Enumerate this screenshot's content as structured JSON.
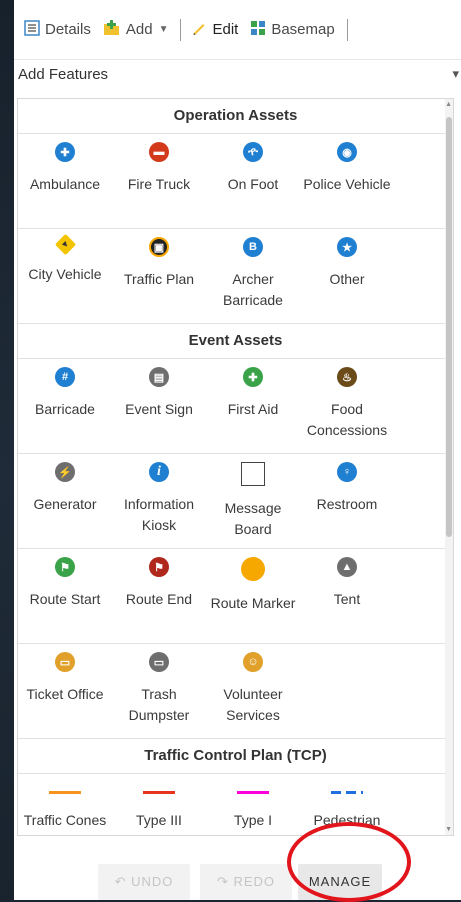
{
  "toolbar": {
    "details": "Details",
    "add": "Add",
    "edit": "Edit",
    "basemap": "Basemap"
  },
  "panel": {
    "title": "Add Features"
  },
  "groups": [
    {
      "header": "Operation Assets",
      "items": [
        {
          "label": "Ambulance",
          "icon": "ambulance-icon",
          "color": "#1f7fd1",
          "glyph": "✚"
        },
        {
          "label": "Fire Truck",
          "icon": "fire-truck-icon",
          "color": "#d33a1b",
          "glyph": "▬"
        },
        {
          "label": "On Foot",
          "icon": "walking-person-icon",
          "color": "#1f7fd1",
          "glyph": "ዯ"
        },
        {
          "label": "Police Vehicle",
          "icon": "police-car-icon",
          "color": "#1f7fd1",
          "glyph": "◉"
        },
        {
          "label": "City Vehicle",
          "icon": "city-vehicle-icon",
          "color": "#f5c400",
          "glyph": "▸"
        },
        {
          "label": "Traffic Plan",
          "icon": "traffic-plan-icon",
          "color": "#222222",
          "glyph": "▣"
        },
        {
          "label": "Archer Barricade",
          "icon": "archer-barricade-icon",
          "color": "#1f7fd1",
          "glyph": "B"
        },
        {
          "label": "Other",
          "icon": "star-badge-icon",
          "color": "#1f7fd1",
          "glyph": "★"
        }
      ]
    },
    {
      "header": "Event Assets",
      "items": [
        {
          "label": "Barricade",
          "icon": "barricade-icon",
          "color": "#1f7fd1",
          "glyph": "#"
        },
        {
          "label": "Event Sign",
          "icon": "event-sign-icon",
          "color": "#6e6e6e",
          "glyph": "▤"
        },
        {
          "label": "First Aid",
          "icon": "first-aid-icon",
          "color": "#3aa34a",
          "glyph": "✚"
        },
        {
          "label": "Food Concessions",
          "icon": "food-icon",
          "color": "#6b4b18",
          "glyph": "♨"
        },
        {
          "label": "Generator",
          "icon": "generator-icon",
          "color": "#6e6e6e",
          "glyph": "⚡"
        },
        {
          "label": "Information Kiosk",
          "icon": "information-icon",
          "color": "#1f7fd1",
          "glyph": "i"
        },
        {
          "label": "Message Board",
          "icon": "message-board-icon",
          "color": "#ffffff",
          "glyph": ""
        },
        {
          "label": "Restroom",
          "icon": "restroom-icon",
          "color": "#1f7fd1",
          "glyph": "♀"
        },
        {
          "label": "Route Start",
          "icon": "route-start-flag-icon",
          "color": "#3aa34a",
          "glyph": "⚑"
        },
        {
          "label": "Route End",
          "icon": "route-end-flag-icon",
          "color": "#b0281c",
          "glyph": "⚑"
        },
        {
          "label": "Route Marker",
          "icon": "route-marker-icon",
          "color": "#f7a800",
          "glyph": ""
        },
        {
          "label": "Tent",
          "icon": "tent-icon",
          "color": "#6e6e6e",
          "glyph": "▲"
        },
        {
          "label": "Ticket Office",
          "icon": "ticket-icon",
          "color": "#e0a02a",
          "glyph": "▭"
        },
        {
          "label": "Trash Dumpster",
          "icon": "trash-dumpster-icon",
          "color": "#6e6e6e",
          "glyph": "▭"
        },
        {
          "label": "Volunteer Services",
          "icon": "volunteer-icon",
          "color": "#e0a02a",
          "glyph": "☺"
        }
      ]
    },
    {
      "header": "Traffic Control Plan (TCP)",
      "items": [
        {
          "label": "Traffic Cones",
          "icon": "traffic-cones-line-icon",
          "color": "#f7941d"
        },
        {
          "label": "Type III Barricades",
          "icon": "type-iii-barricades-line-icon",
          "color": "#e8341c"
        },
        {
          "label": "Type I Barricades",
          "icon": "type-i-barricades-line-icon",
          "color": "#ff00dc"
        },
        {
          "label": "Pedestrian Fencing",
          "icon": "pedestrian-fencing-line-icon",
          "color": "#1f6fe0"
        }
      ]
    }
  ],
  "bottom": {
    "undo": "UNDO",
    "redo": "REDO",
    "manage": "MANAGE"
  }
}
